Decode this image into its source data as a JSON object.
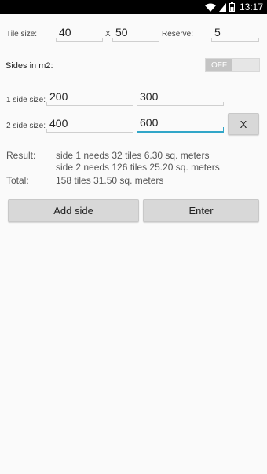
{
  "status": {
    "time": "13:17",
    "icons": [
      "wifi-icon",
      "signal-icon",
      "battery-icon"
    ]
  },
  "tile": {
    "label": "Tile size:",
    "width": "40",
    "separator": "X",
    "height": "50",
    "reserve_label": "Reserve:",
    "reserve": "5"
  },
  "sides_m2": {
    "label": "Sides in m2:",
    "toggle_text": "OFF",
    "toggle_on": false
  },
  "sides": [
    {
      "label": "1 side size:",
      "a": "200",
      "b": "300"
    },
    {
      "label": "2 side size:",
      "a": "400",
      "b": "600"
    }
  ],
  "remove_button": "X",
  "result": {
    "label": "Result:",
    "lines": [
      "side 1 needs 32 tiles 6.30 sq. meters",
      "side 2 needs 126 tiles 25.20 sq. meters"
    ],
    "total_label": "Total:",
    "total_text": "158 tiles 31.50 sq. meters"
  },
  "actions": {
    "add_side": "Add side",
    "enter": "Enter"
  },
  "colors": {
    "accent": "#31a6c8",
    "background": "#fafafa",
    "button": "#d8d8d8"
  }
}
